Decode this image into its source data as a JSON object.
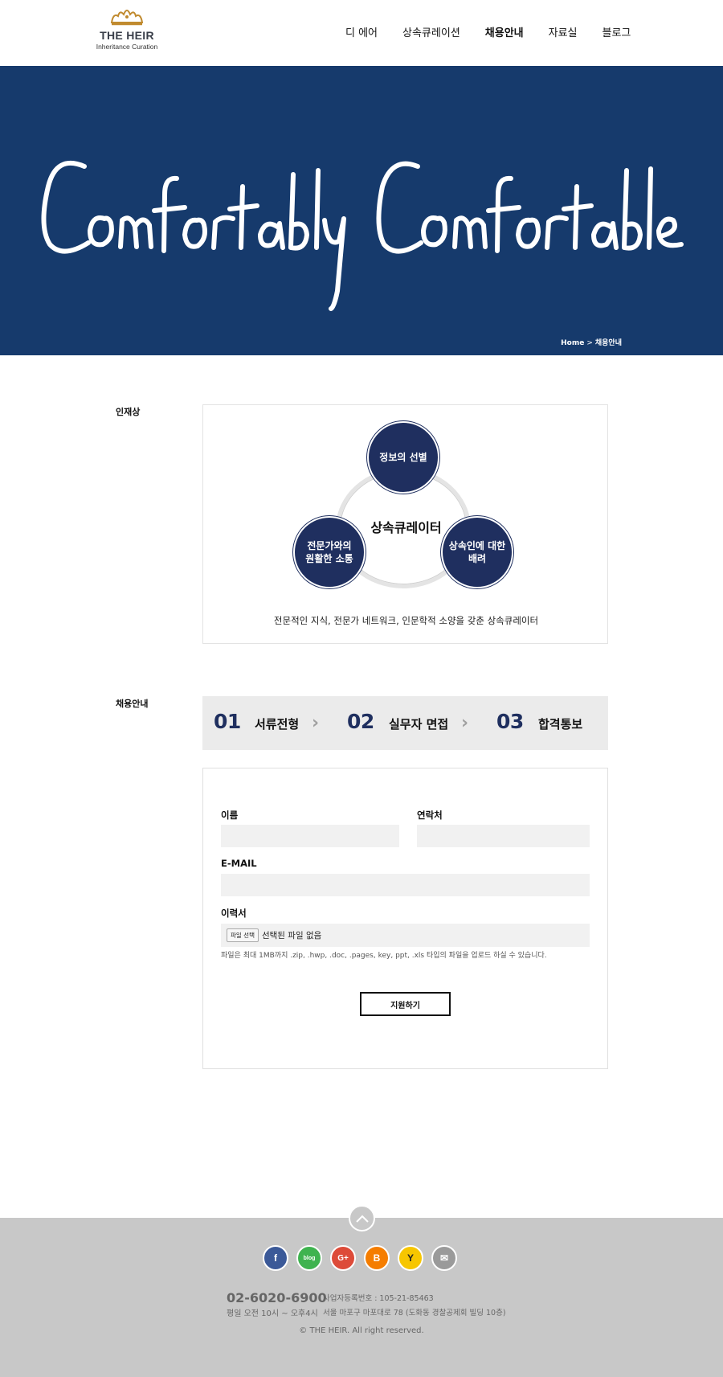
{
  "header": {
    "logo_name": "THE HEIR",
    "logo_sub": "Inheritance Curation",
    "nav": [
      {
        "label": "디 에어",
        "active": false
      },
      {
        "label": "상속큐레이션",
        "active": false
      },
      {
        "label": "채용안내",
        "active": true
      },
      {
        "label": "자료실",
        "active": false
      },
      {
        "label": "블로그",
        "active": false
      }
    ]
  },
  "hero": {
    "script_text": "Comfortably Comfortable",
    "breadcrumb_home": "Home",
    "breadcrumb_sep": ">",
    "breadcrumb_current": "채용안내",
    "bg_color": "#163a6c"
  },
  "talent": {
    "label": "인재상",
    "center": "상속큐레이터",
    "node_top": "정보의 선별",
    "node_left_1": "전문가와의",
    "node_left_2": "원활한 소통",
    "node_right_1": "상속인에 대한",
    "node_right_2": "배려",
    "caption": "전문적인 지식, 전문가 네트워크, 인문학적 소양을 갖춘 상속큐레이터"
  },
  "recruit": {
    "label": "채용안내",
    "steps": [
      {
        "num": "01",
        "name": "서류전형"
      },
      {
        "num": "02",
        "name": "실무자 면접"
      },
      {
        "num": "03",
        "name": "합격통보"
      }
    ]
  },
  "form": {
    "name_label": "이름",
    "contact_label": "연락처",
    "email_label": "E-MAIL",
    "resume_label": "이력서",
    "file_button": "파일 선택",
    "file_status": "선택된 파일 없음",
    "help": "파일은 최대 1MB까지 .zip, .hwp, .doc, .pages, key, ppt, .xls 타입의 파일을 업로드 하실 수 있습니다.",
    "submit": "지원하기"
  },
  "footer": {
    "socials": [
      {
        "icon": "facebook-icon",
        "glyph": "f",
        "color": "#3b5998"
      },
      {
        "icon": "blog-icon",
        "glyph": "blog",
        "color": "#3fb34f"
      },
      {
        "icon": "google-plus-icon",
        "glyph": "G+",
        "color": "#dd4b39"
      },
      {
        "icon": "blogger-icon",
        "glyph": "B",
        "color": "#f57d00"
      },
      {
        "icon": "yellow-id-icon",
        "glyph": "Y",
        "color": "#f7c600"
      },
      {
        "icon": "mail-icon",
        "glyph": "✉",
        "color": "#9a9a9a"
      }
    ],
    "phone": "02-6020-6900",
    "hours": "평일 오전 10시 ~ 오후4시",
    "biz_no": "사업자등록번호 : 105-21-85463",
    "address": "서울 마포구 마포대로 78 (도화동 경찰공제회 빌딩 10층)",
    "copyright": "© THE HEIR. All right reserved."
  }
}
